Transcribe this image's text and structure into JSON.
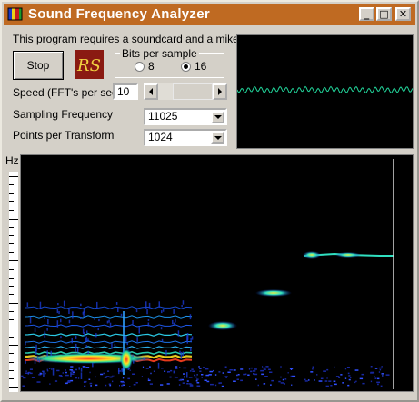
{
  "window": {
    "title": "Sound Frequency Analyzer",
    "title_bar_color": "#bf6a22",
    "buttons": {
      "minimize": "_",
      "maximize": "□",
      "close": "✕"
    }
  },
  "notice": "This program requires a soundcard  and a mike",
  "stop_button": "Stop",
  "logo_text": "RS",
  "bits_per_sample": {
    "legend": "Bits per sample",
    "options": [
      "8",
      "16"
    ],
    "selected": "16"
  },
  "speed": {
    "label": "Speed (FFT's per sec)",
    "value": "10"
  },
  "sampling_frequency": {
    "label": "Sampling Frequency",
    "value": "11025"
  },
  "points_per_transform": {
    "label": "Points per Transform",
    "value": "1024"
  },
  "spectrogram": {
    "axis_label": "Hz",
    "background": "#000000"
  },
  "oscilloscope": {
    "trace_color": "#22d49a",
    "background": "#000000"
  },
  "icons": [
    "app-icon",
    "rs-logo",
    "minimize-icon",
    "maximize-icon",
    "close-icon",
    "scroll-left-arrow-icon",
    "scroll-right-arrow-icon",
    "dropdown-arrow-icon"
  ]
}
